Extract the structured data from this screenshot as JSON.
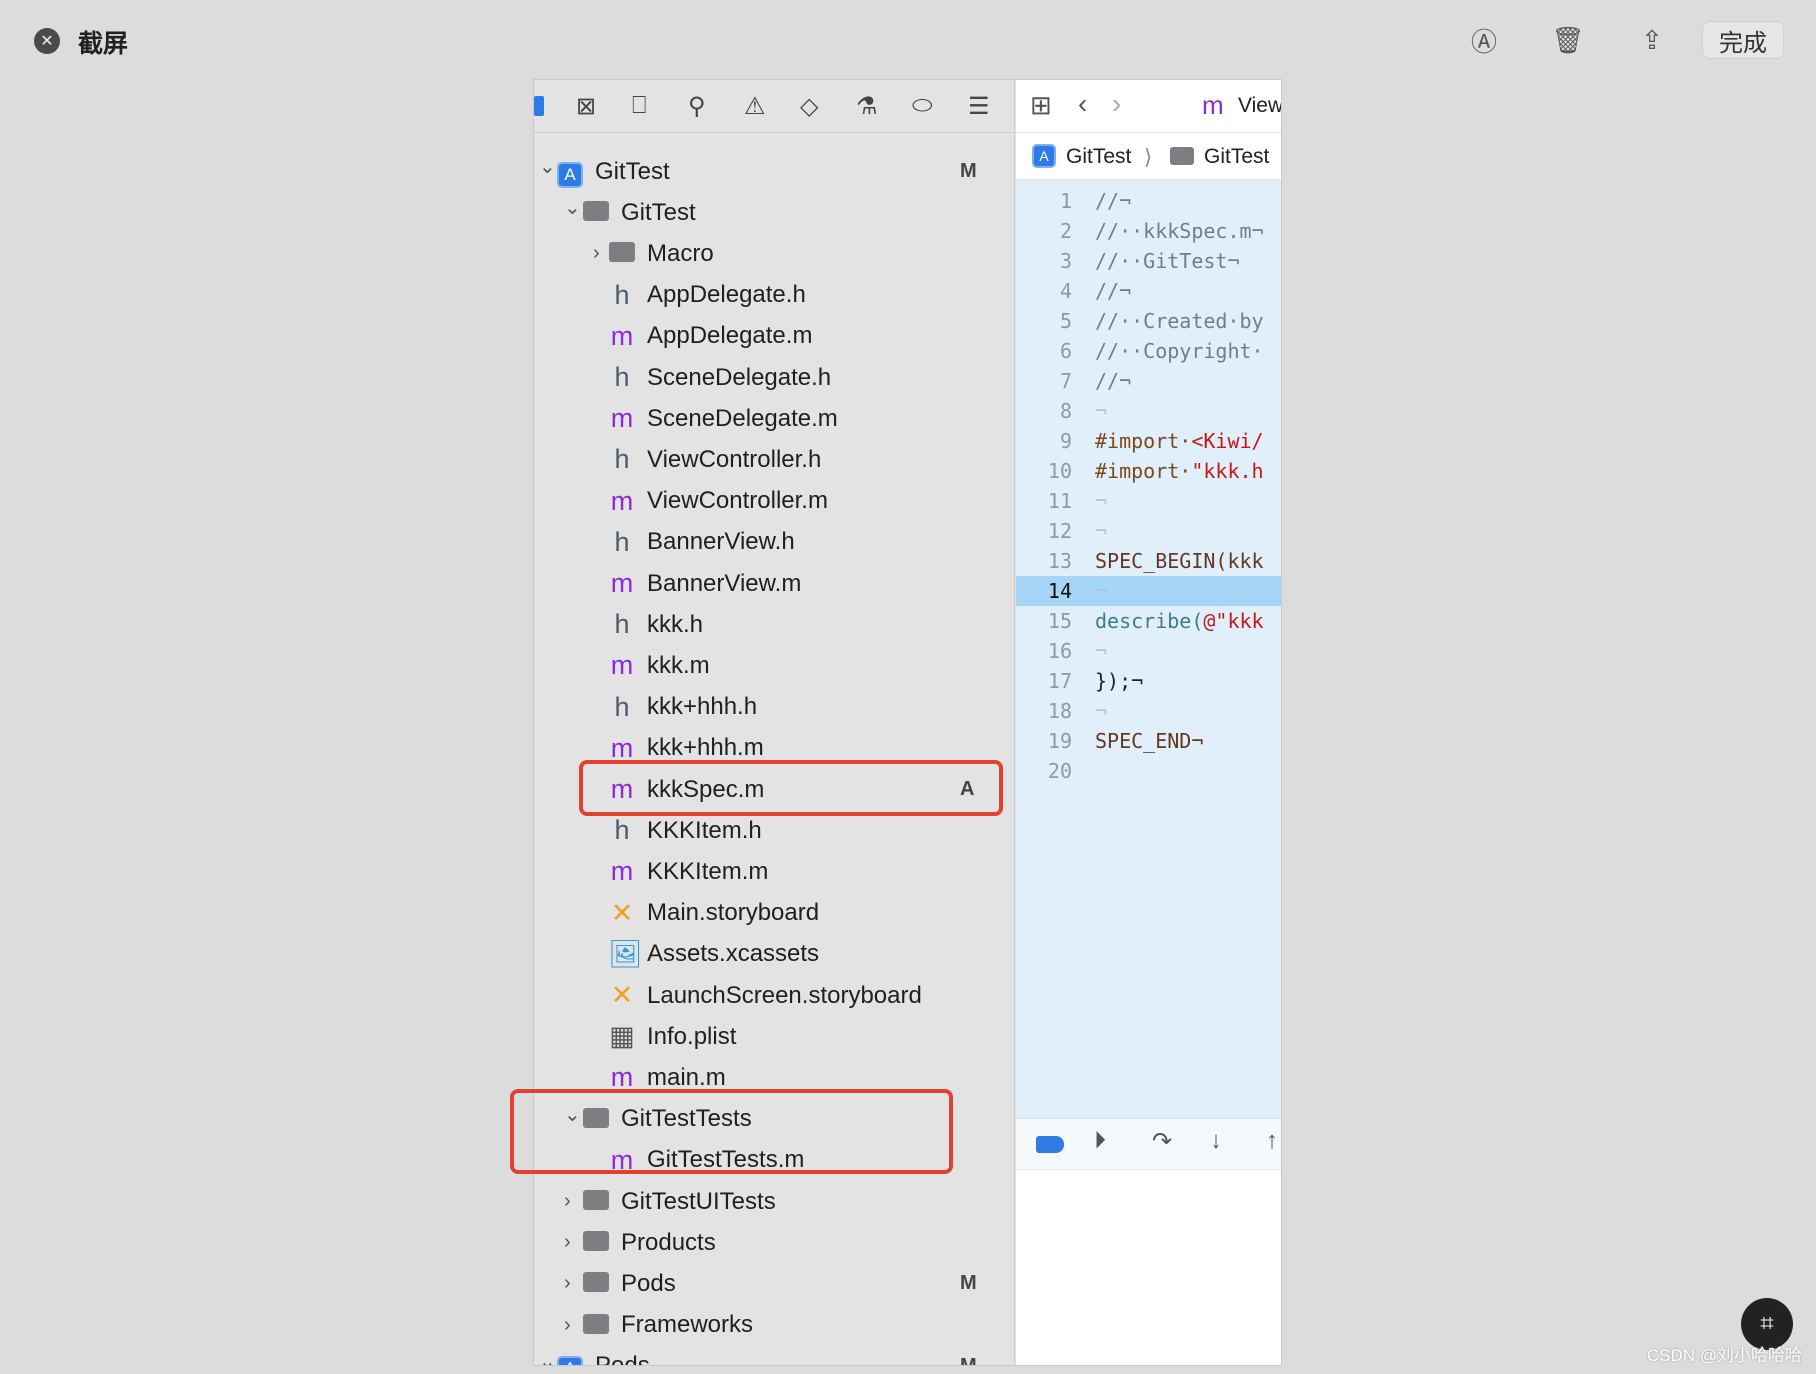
{
  "topbar": {
    "title": "截屏",
    "close_icon": "close-circle-icon",
    "done_label": "完成",
    "icons": [
      "markup-icon",
      "trash-icon",
      "share-icon"
    ]
  },
  "navigator": {
    "toolbar_icons": [
      "project-navigator-icon",
      "source-control-icon",
      "bookmark-icon",
      "find-icon",
      "issue-icon",
      "test-icon",
      "debug-icon",
      "breakpoint-icon",
      "report-icon"
    ],
    "rows": [
      {
        "label": "GitTest",
        "level": 0,
        "type": "app",
        "disclosure": "open",
        "badge": "M"
      },
      {
        "label": "GitTest",
        "level": 1,
        "type": "folder",
        "disclosure": "open"
      },
      {
        "label": "Macro",
        "level": 2,
        "type": "folder",
        "disclosure": "closed"
      },
      {
        "label": "AppDelegate.h",
        "level": 2,
        "type": "h"
      },
      {
        "label": "AppDelegate.m",
        "level": 2,
        "type": "m"
      },
      {
        "label": "SceneDelegate.h",
        "level": 2,
        "type": "h"
      },
      {
        "label": "SceneDelegate.m",
        "level": 2,
        "type": "m"
      },
      {
        "label": "ViewController.h",
        "level": 2,
        "type": "h"
      },
      {
        "label": "ViewController.m",
        "level": 2,
        "type": "m"
      },
      {
        "label": "BannerView.h",
        "level": 2,
        "type": "h"
      },
      {
        "label": "BannerView.m",
        "level": 2,
        "type": "m"
      },
      {
        "label": "kkk.h",
        "level": 2,
        "type": "h"
      },
      {
        "label": "kkk.m",
        "level": 2,
        "type": "m"
      },
      {
        "label": "kkk+hhh.h",
        "level": 2,
        "type": "h"
      },
      {
        "label": "kkk+hhh.m",
        "level": 2,
        "type": "m"
      },
      {
        "label": "kkkSpec.m",
        "level": 2,
        "type": "m",
        "badge": "A"
      },
      {
        "label": "KKKItem.h",
        "level": 2,
        "type": "h"
      },
      {
        "label": "KKKItem.m",
        "level": 2,
        "type": "m"
      },
      {
        "label": "Main.storyboard",
        "level": 2,
        "type": "storyboard"
      },
      {
        "label": "Assets.xcassets",
        "level": 2,
        "type": "assets"
      },
      {
        "label": "LaunchScreen.storyboard",
        "level": 2,
        "type": "storyboard"
      },
      {
        "label": "Info.plist",
        "level": 2,
        "type": "plist"
      },
      {
        "label": "main.m",
        "level": 2,
        "type": "m"
      },
      {
        "label": "GitTestTests",
        "level": 1,
        "type": "folder",
        "disclosure": "open"
      },
      {
        "label": "GitTestTests.m",
        "level": 2,
        "type": "m"
      },
      {
        "label": "GitTestUITests",
        "level": 1,
        "type": "folder",
        "disclosure": "closed"
      },
      {
        "label": "Products",
        "level": 1,
        "type": "folder",
        "disclosure": "closed"
      },
      {
        "label": "Pods",
        "level": 1,
        "type": "folder",
        "disclosure": "closed",
        "badge": "M"
      },
      {
        "label": "Frameworks",
        "level": 1,
        "type": "folder",
        "disclosure": "closed"
      },
      {
        "label": "Pods",
        "level": 0,
        "type": "app",
        "disclosure": "open",
        "badge": "M"
      }
    ]
  },
  "editor": {
    "tab_label": "View",
    "breadcrumb": [
      "GitTest",
      "GitTest"
    ],
    "current_line": 14,
    "lines": [
      {
        "n": "1",
        "t": "//¬",
        "c": "comment"
      },
      {
        "n": "2",
        "t": "//··kkkSpec.m¬",
        "c": "comment"
      },
      {
        "n": "3",
        "t": "//··GitTest¬",
        "c": "comment"
      },
      {
        "n": "4",
        "t": "//¬",
        "c": "comment"
      },
      {
        "n": "5",
        "t": "//··Created·by",
        "c": "comment"
      },
      {
        "n": "6",
        "t": "//··Copyright·",
        "c": "comment"
      },
      {
        "n": "7",
        "t": "//¬",
        "c": "comment"
      },
      {
        "n": "8",
        "t": "¬",
        "c": "inv"
      },
      {
        "n": "9",
        "t": "#import·<Kiwi/",
        "c": "import"
      },
      {
        "n": "10",
        "t": "#import·\"kkk.h",
        "c": "import"
      },
      {
        "n": "11",
        "t": "¬",
        "c": "inv"
      },
      {
        "n": "12",
        "t": "¬",
        "c": "inv"
      },
      {
        "n": "13",
        "t": "SPEC_BEGIN(kkk",
        "c": "macro"
      },
      {
        "n": "14",
        "t": "¬",
        "c": "inv"
      },
      {
        "n": "15",
        "t": "describe(@\"kkk",
        "c": "call"
      },
      {
        "n": "16",
        "t": "¬",
        "c": "inv"
      },
      {
        "n": "17",
        "t": "});¬",
        "c": "plain"
      },
      {
        "n": "18",
        "t": "¬",
        "c": "inv"
      },
      {
        "n": "19",
        "t": "SPEC_END¬",
        "c": "macro"
      },
      {
        "n": "20",
        "t": "",
        "c": "plain"
      }
    ],
    "debug_icons": [
      "breakpoints-toggle-icon",
      "continue-icon",
      "step-over-icon",
      "step-into-icon",
      "step-out-icon"
    ]
  },
  "watermark": "CSDN @刘小哈哈哈",
  "colors": {
    "highlight": "#e2412f",
    "m_file": "#8a2be2",
    "h_file": "#4b5a70",
    "accent": "#2f7be6"
  }
}
